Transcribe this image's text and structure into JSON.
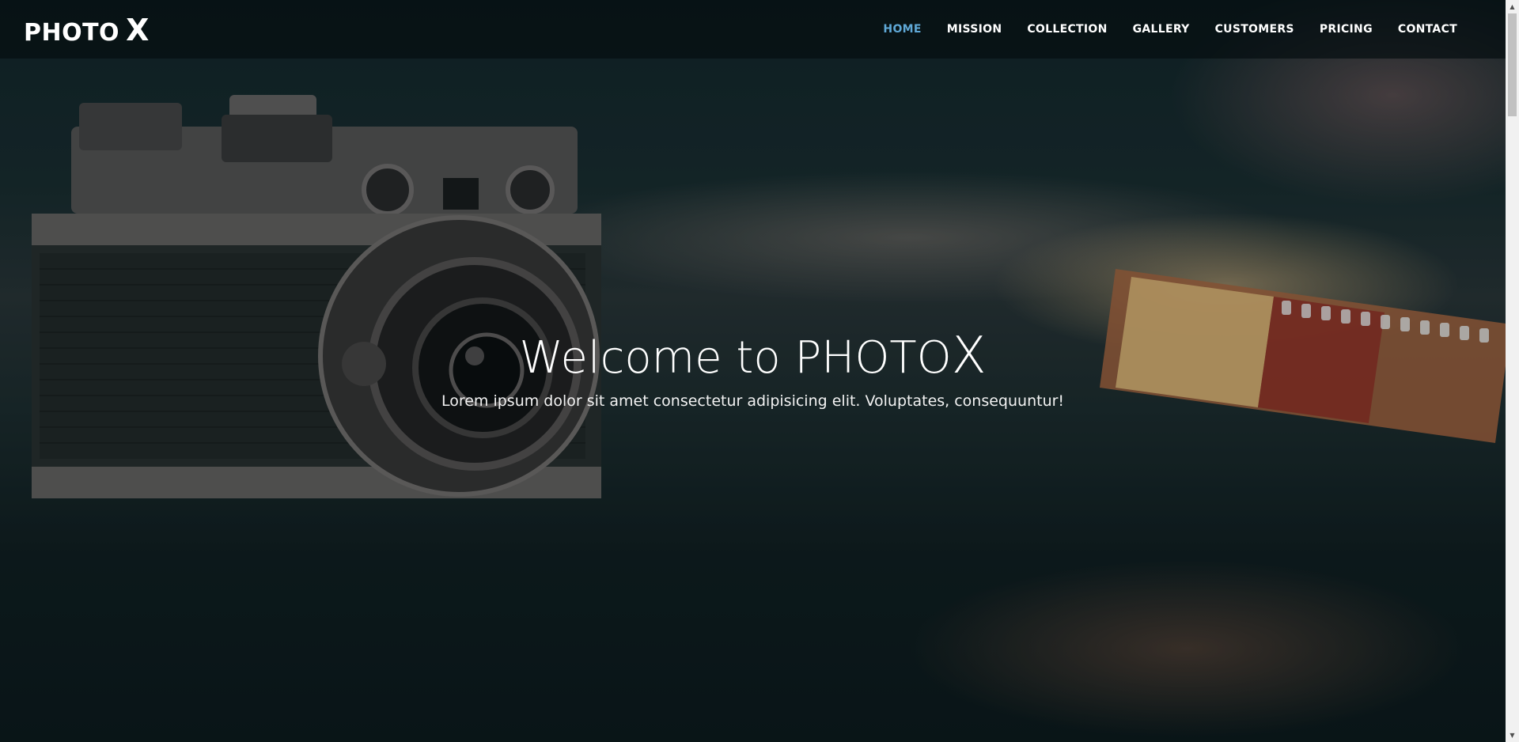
{
  "brand": {
    "name": "PHOTO",
    "suffix": "X"
  },
  "nav": {
    "items": [
      {
        "label": "HOME",
        "active": true
      },
      {
        "label": "MISSION",
        "active": false
      },
      {
        "label": "COLLECTION",
        "active": false
      },
      {
        "label": "GALLERY",
        "active": false
      },
      {
        "label": "CUSTOMERS",
        "active": false
      },
      {
        "label": "PRICING",
        "active": false
      },
      {
        "label": "CONTACT",
        "active": false
      }
    ]
  },
  "hero": {
    "title": "Welcome to PHOTO",
    "title_suffix": "X",
    "subtitle": "Lorem ipsum dolor sit amet consectetur adipisicing elit. Voluptates, consequuntur!"
  },
  "colors": {
    "active_nav": "#5fa8d6",
    "nav_background": "#060e10",
    "text": "#ffffff"
  },
  "icons": {
    "scroll_up": "triangle-up-icon",
    "scroll_down": "triangle-down-icon"
  }
}
